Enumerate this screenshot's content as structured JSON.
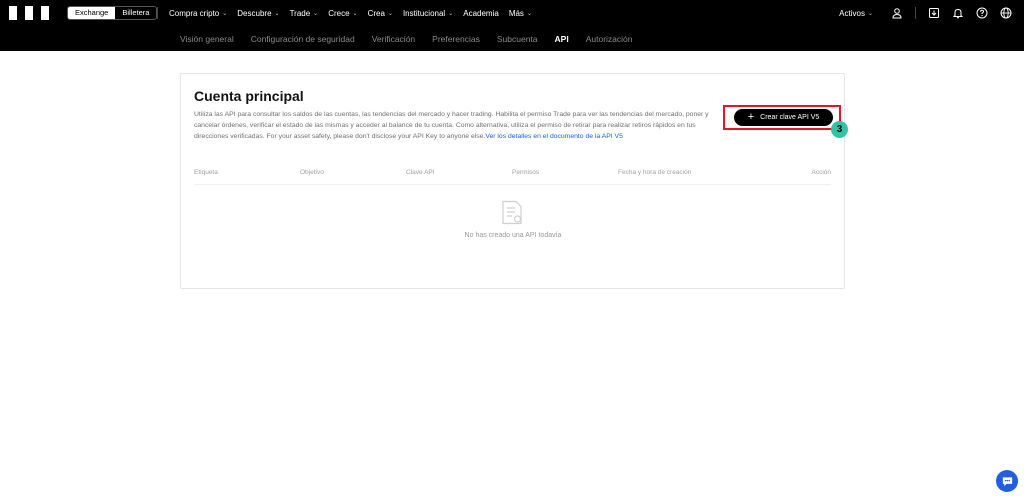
{
  "header": {
    "segments": [
      "Exchange",
      "Billetera"
    ],
    "nav": [
      {
        "label": "Compra cripto",
        "chevron": true
      },
      {
        "label": "Descubre",
        "chevron": true
      },
      {
        "label": "Trade",
        "chevron": true
      },
      {
        "label": "Crece",
        "chevron": true
      },
      {
        "label": "Crea",
        "chevron": true
      },
      {
        "label": "Institucional",
        "chevron": true
      },
      {
        "label": "Academia",
        "chevron": false
      },
      {
        "label": "Más",
        "chevron": true
      }
    ],
    "assets_label": "Activos",
    "icons": [
      "user-icon",
      "download-icon",
      "bell-icon",
      "help-icon",
      "globe-icon"
    ]
  },
  "subnav": {
    "items": [
      "Visión general",
      "Configuración de seguridad",
      "Verificación",
      "Preferencias",
      "Subcuenta",
      "API",
      "Autorización"
    ],
    "active": "API"
  },
  "card": {
    "title": "Cuenta principal",
    "description": "Utiliza las API para consultar los saldos de las cuentas, las tendencias del mercado y hacer trading. Habilita el permiso Trade para ver las tendencias del mercado, poner y cancelar órdenes, verificar el estado de las mismas y acceder al balance de tu cuenta. Como alternativa, utiliza el permiso de retirar para realizar retiros rápidos en tus direcciones verificadas. For your asset safety, please don't disclose your API Key to anyone else.",
    "doc_link": "Ver los detalles en el documento de la API V5",
    "create_button": "Crear clave API V5",
    "step_badge": "3",
    "columns": [
      "Etiqueta",
      "Objetivo",
      "Clave API",
      "Permisos",
      "Fecha y hora de creación",
      "Acción"
    ],
    "empty_text": "No has creado una API todavía"
  },
  "colors": {
    "accent": "#000000",
    "highlight": "#e0162b",
    "badge": "#2ec4a6",
    "link": "#1a5fd6",
    "chat": "#1f5fe0"
  }
}
